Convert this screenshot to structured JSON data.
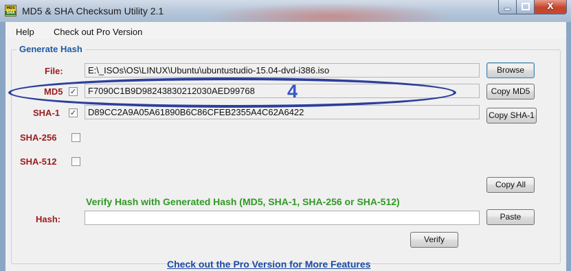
{
  "window": {
    "title": "MD5 & SHA Checksum Utility 2.1",
    "icon_label_top": "MD5",
    "icon_label_bottom": "SHA",
    "close_glyph": "X"
  },
  "menu": {
    "items": [
      "Help",
      "Check out Pro Version"
    ]
  },
  "generate": {
    "group_label": "Generate Hash",
    "file": {
      "label": "File:",
      "value": "E:\\_ISOs\\OS\\LINUX\\Ubuntu\\ubuntustudio-15.04-dvd-i386.iso",
      "button": "Browse"
    },
    "md5": {
      "label": "MD5",
      "checked": true,
      "value": "F7090C1B9D98243830212030AED99768",
      "button": "Copy MD5"
    },
    "sha1": {
      "label": "SHA-1",
      "checked": true,
      "value": "D89CC2A9A05A61890B6C86CFEB2355A4C62A6422",
      "button": "Copy SHA-1"
    },
    "sha256": {
      "label": "SHA-256",
      "checked": false
    },
    "sha512": {
      "label": "SHA-512",
      "checked": false
    },
    "copy_all": "Copy All"
  },
  "verify": {
    "title": "Verify Hash with Generated Hash (MD5, SHA-1, SHA-256 or SHA-512)",
    "hash_label": "Hash:",
    "hash_value": "",
    "paste_button": "Paste",
    "verify_button": "Verify"
  },
  "footer": {
    "link": "Check out the Pro Version for More Features"
  },
  "annotation": {
    "number": "4",
    "color": "#2c3f9c"
  }
}
